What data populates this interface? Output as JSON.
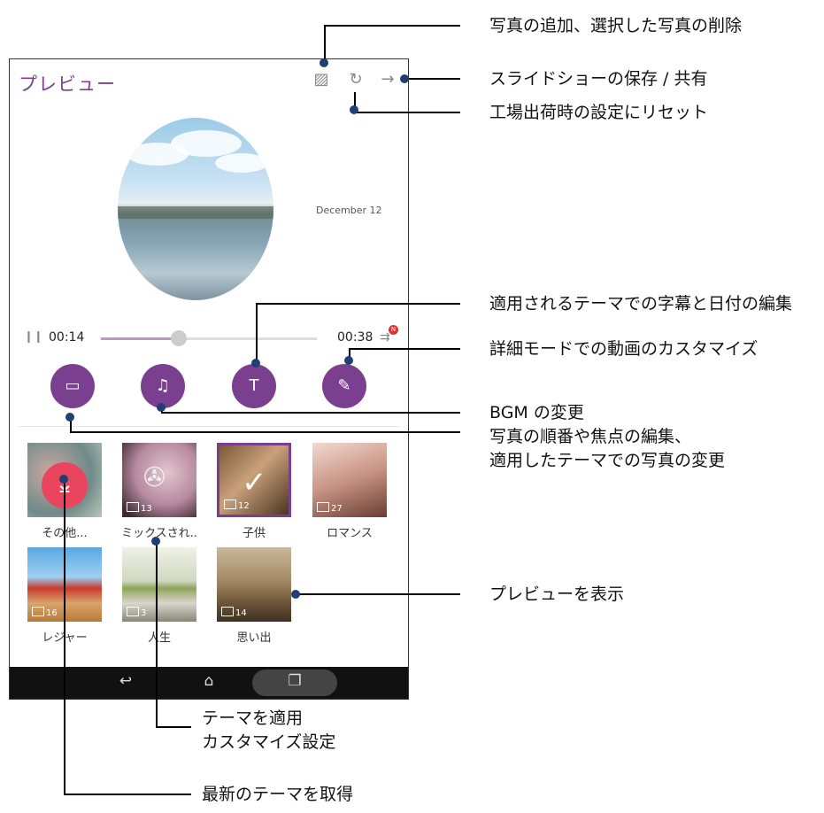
{
  "screen": {
    "title": "プレビュー",
    "header_icons": [
      "add-photo-icon",
      "reset-icon",
      "arrow-right-icon"
    ],
    "preview": {
      "date_text": "December 12"
    },
    "player": {
      "current_time": "00:14",
      "end_time": "00:38",
      "progress_fraction": 0.36,
      "queue_badge": "N"
    },
    "tools": [
      {
        "name": "photo-edit",
        "icon": "image-icon",
        "glyph": "▭"
      },
      {
        "name": "music",
        "icon": "music-note-icon",
        "glyph": "♫"
      },
      {
        "name": "text",
        "icon": "text-t-icon",
        "glyph": "T"
      },
      {
        "name": "customize-video",
        "icon": "video-edit-icon",
        "glyph": "✎"
      }
    ],
    "themes": [
      {
        "label": "その他...",
        "count": "",
        "icon": "download-icon"
      },
      {
        "label": "ミックスされ..",
        "count": "13"
      },
      {
        "label": "子供",
        "count": "12",
        "selected": true
      },
      {
        "label": "ロマンス",
        "count": "27"
      },
      {
        "label": "レジャー",
        "count": "16"
      },
      {
        "label": "人生",
        "count": "3"
      },
      {
        "label": "思い出",
        "count": "14"
      }
    ],
    "nav": {
      "back_icon": "↩",
      "home_icon": "⌂",
      "recent_icon": "❐"
    }
  },
  "callouts": {
    "add_delete": "写真の追加、選択した写真の削除",
    "save_share": "スライドショーの保存 / 共有",
    "reset": "工場出荷時の設定にリセット",
    "edit_caption": "適用されるテーマでの字幕と日付の編集",
    "advanced_mode": "詳細モードでの動画のカスタマイズ",
    "bgm": "BGM の変更",
    "photo_order_1": "写真の順番や焦点の編集、",
    "photo_order_2": "適用したテーマでの写真の変更",
    "preview": "プレビューを表示",
    "apply_theme_1": "テーマを適用",
    "apply_theme_2": "カスタマイズ設定",
    "latest_theme": "最新のテーマを取得"
  },
  "colors": {
    "accent": "#7b3f8f",
    "download": "#e9455f",
    "callout_dot": "#1f3f75"
  }
}
